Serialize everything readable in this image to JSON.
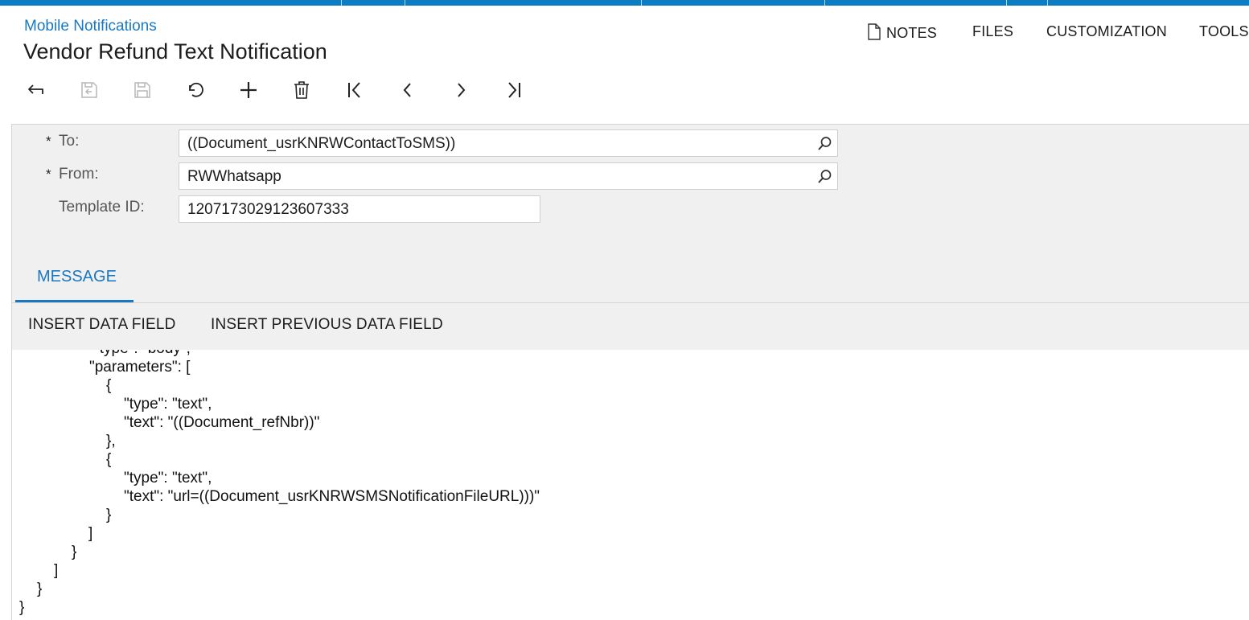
{
  "breadcrumb": "Mobile Notifications",
  "title": "Vendor Refund Text Notification",
  "top_actions": {
    "notes": "NOTES",
    "files": "FILES",
    "customization": "CUSTOMIZATION",
    "tools": "TOOLS"
  },
  "toolbar_icons": [
    "back-icon",
    "save-and-close-icon",
    "save-icon",
    "cancel-icon",
    "add-icon",
    "delete-icon",
    "first-record-icon",
    "previous-record-icon",
    "next-record-icon",
    "last-record-icon"
  ],
  "form": {
    "to": {
      "label": "To:",
      "required_mark": "*",
      "value": "((Document_usrKNRWContactToSMS))"
    },
    "from": {
      "label": "From:",
      "required_mark": "*",
      "value": "RWWhatsapp"
    },
    "template_id": {
      "label": "Template ID:",
      "value": "1207173029123607333"
    }
  },
  "tabs": {
    "message": "MESSAGE"
  },
  "message_toolbar": {
    "insert_data_field": "INSERT DATA FIELD",
    "insert_previous_data_field": "INSERT PREVIOUS DATA FIELD"
  },
  "editor_lines": [
    "\"type\": \"body\",",
    "\"parameters\": [",
    "{",
    "\"type\": \"text\",",
    "\"text\": \"((Document_refNbr))\"",
    "},",
    "{",
    "\"type\": \"text\",",
    "\"text\": \"url=((Document_usrKNRWSMSNotificationFileURL)))\"",
    "}",
    "]",
    "}",
    "]",
    "}",
    "}"
  ],
  "colors": {
    "accent": "#1a78c2",
    "topbar": "#0c7cc5",
    "panel": "#f0f0f0"
  }
}
